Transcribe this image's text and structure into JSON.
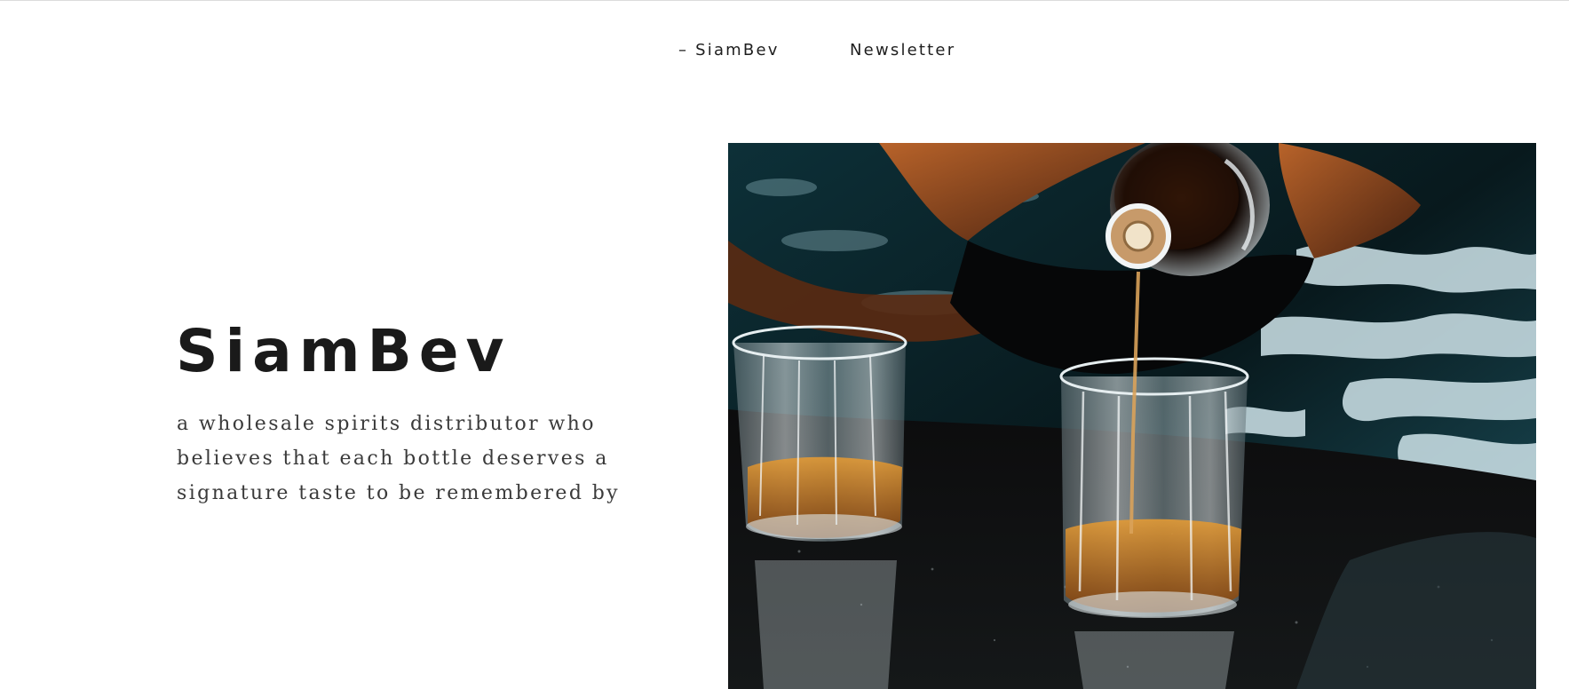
{
  "nav": {
    "items": [
      {
        "label": "– SiamBev"
      },
      {
        "label": "Newsletter"
      }
    ]
  },
  "hero": {
    "title": "SiamBev",
    "tagline": "a wholesale spirits distributor who believes that each bottle deserves a signature taste to be remembered by",
    "image_description_icon": "whiskey-pour-photo"
  },
  "colors": {
    "text": "#1a1a1a",
    "whiskey": "#b8731e",
    "water": "#0e2a30"
  }
}
